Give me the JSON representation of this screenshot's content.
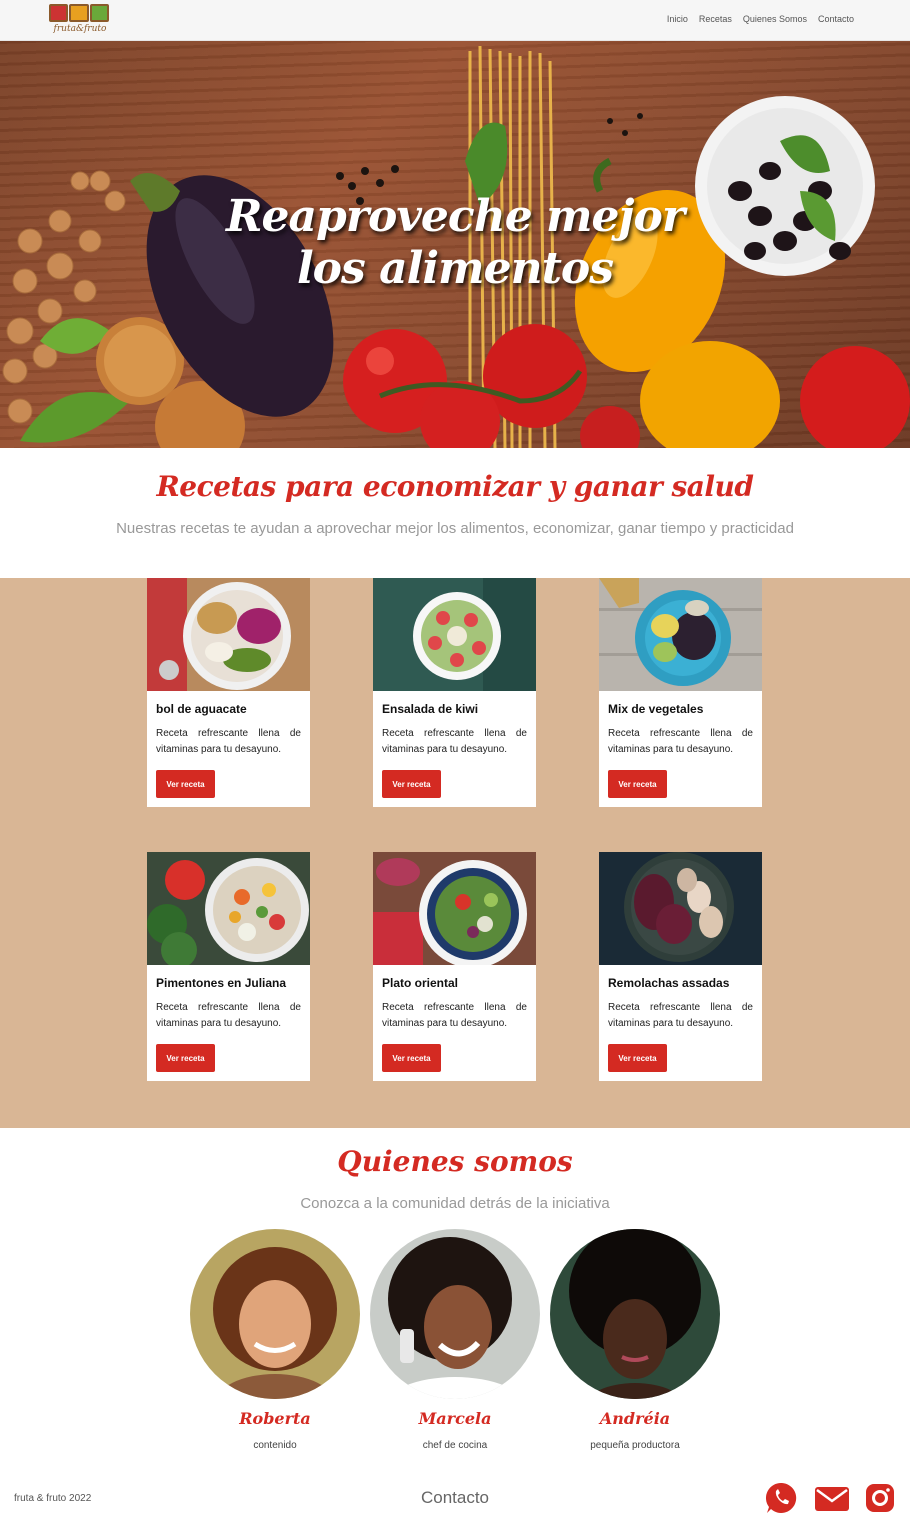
{
  "brand": {
    "logo_text": "fruta&fruto"
  },
  "nav": {
    "items": [
      {
        "label": "Inicio"
      },
      {
        "label": "Recetas"
      },
      {
        "label": "Quienes Somos"
      },
      {
        "label": "Contacto"
      }
    ]
  },
  "hero": {
    "title": "Reaproveche mejor los alimentos"
  },
  "recipes": {
    "title": "Recetas para economizar y ganar salud",
    "subtitle": "Nuestras recetas te ayudan a aprovechar mejor los alimentos, economizar, ganar tiempo y practicidad",
    "cards": [
      {
        "title": "bol de aguacate",
        "description": "Receta refrescante llena de vitaminas para tu desayuno.",
        "button": "Ver receta"
      },
      {
        "title": "Ensalada de kiwi",
        "description": "Receta refrescante llena de vitaminas para tu desayuno.",
        "button": "Ver receta"
      },
      {
        "title": "Mix de vegetales",
        "description": "Receta refrescante llena de vitaminas para tu desayuno.",
        "button": "Ver receta"
      },
      {
        "title": "Pimentones en Juliana",
        "description": "Receta refrescante llena de vitaminas para tu desayuno.",
        "button": "Ver receta"
      },
      {
        "title": "Plato oriental",
        "description": "Receta refrescante llena de vitaminas para tu desayuno.",
        "button": "Ver receta"
      },
      {
        "title": "Remolachas assadas",
        "description": "Receta refrescante llena de vitaminas para tu desayuno.",
        "button": "Ver receta"
      }
    ]
  },
  "about": {
    "title": "Quienes somos",
    "subtitle": "Conozca a la comunidad detrás de la iniciativa",
    "people": [
      {
        "name": "Roberta",
        "role": "contenido"
      },
      {
        "name": "Marcela",
        "role": "chef de cocina"
      },
      {
        "name": "Andréia",
        "role": "pequeña productora"
      }
    ]
  },
  "footer": {
    "copyright": "fruta & fruto 2022",
    "contact_label": "Contacto",
    "social_icons": [
      "whatsapp-icon",
      "mail-icon",
      "instagram-icon"
    ]
  },
  "colors": {
    "accent": "#d42a22",
    "band": "#d9b695",
    "nav_bg": "#f6f6f6"
  }
}
